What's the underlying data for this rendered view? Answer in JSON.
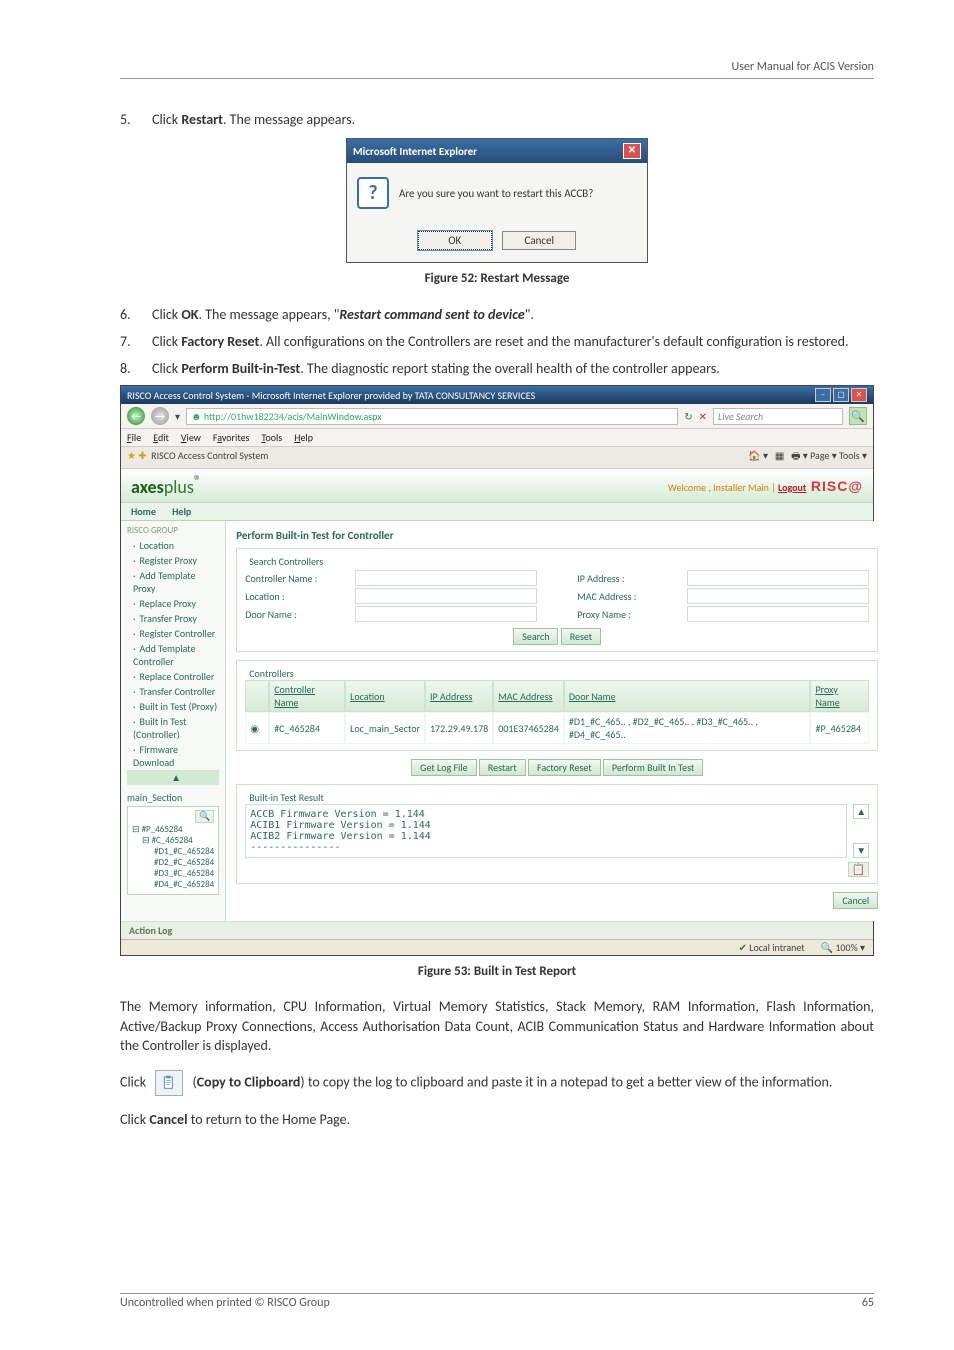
{
  "header": {
    "doc_title": "User Manual for ACIS Version"
  },
  "list": {
    "i5": {
      "num": "5.",
      "pre": "Click ",
      "b": "Restart",
      "post": ". The message appears."
    },
    "i6": {
      "num": "6.",
      "pre": "Click ",
      "b": "OK",
      "mid": ". The message appears, \"",
      "bi": "Restart command sent to device",
      "post": "\"."
    },
    "i7": {
      "num": "7.",
      "pre": "Click ",
      "b": "Factory Reset",
      "post": ". All configurations on the Controllers are reset and the manufacturer's default configuration is restored."
    },
    "i8": {
      "num": "8.",
      "pre": "Click ",
      "b": "Perform Built-in-Test",
      "post": ". The diagnostic report stating the overall health of the controller appears."
    }
  },
  "dialog": {
    "title": "Microsoft Internet Explorer",
    "message": "Are you sure you want to restart this ACCB?",
    "ok": "OK",
    "cancel": "Cancel"
  },
  "caption1": "Figure 52: Restart Message",
  "browser": {
    "titlebar": "RISCO Access Control System - Microsoft Internet Explorer provided by TATA CONSULTANCY SERVICES",
    "url": "http://01hw182234/acis/MainWindow.aspx",
    "search_placeholder": "Live Search",
    "menus": {
      "file": "File",
      "edit": "Edit",
      "view": "View",
      "fav": "Favorites",
      "tools": "Tools",
      "help": "Help"
    },
    "tab_label": "RISCO Access Control System",
    "toolbar_right": "Page ▾   Tools ▾",
    "brand_html": "axesplus",
    "welcome": "Welcome ,  Installer Main  |  ",
    "logout": "Logout",
    "logo": "RISC@",
    "apptabs": {
      "home": "Home",
      "help": "Help"
    },
    "sidebar": {
      "group": "RISCO GROUP",
      "items": [
        "Location",
        "Register Proxy",
        "Add Template Proxy",
        "Replace Proxy",
        "Transfer Proxy",
        "Register Controller",
        "Add Template Controller",
        "Replace Controller",
        "Transfer Controller",
        "Built in Test (Proxy)",
        "Built in Test (Controller)",
        "Firmware Download"
      ],
      "section": "main_Section",
      "tree": [
        "#P_465284",
        "#C_465284",
        "#D1_#C_465284",
        "#D2_#C_465284",
        "#D3_#C_465284",
        "#D4_#C_465284"
      ]
    },
    "main": {
      "heading": "Perform Built-in Test for Controller",
      "fs_search": {
        "legend": "Search Controllers",
        "ctrlname": "Controller Name :",
        "location": "Location :",
        "doorname": "Door Name :",
        "ip": "IP Address :",
        "mac": "MAC Address :",
        "proxy": "Proxy Name :",
        "search": "Search",
        "reset": "Reset"
      },
      "fs_ctrl": {
        "legend": "Controllers",
        "cols": [
          "Controller Name",
          "Location",
          "IP Address",
          "MAC Address",
          "Door Name",
          "Proxy Name"
        ],
        "row": {
          "sel": "◉",
          "name": "#C_465284",
          "loc": "Loc_main_Sector",
          "ip": "172.29.49.178",
          "mac": "001E37465284",
          "doors": "#D1_#C_465.. , #D2_#C_465.. , #D3_#C_465.. , #D4_#C_465..",
          "proxy": "#P_465284"
        }
      },
      "btns": {
        "getlog": "Get Log File",
        "restart": "Restart",
        "factory": "Factory Reset",
        "perform": "Perform Built In Test"
      },
      "fs_result": {
        "legend": "Built-in Test Result",
        "lines": [
          "ACCB Firmware Version = 1.144",
          "ACIB1 Firmware Version = 1.144",
          "ACIB2 Firmware Version = 1.144",
          "---------------"
        ]
      },
      "cancel": "Cancel"
    },
    "actionlog": "Action Log",
    "status": {
      "zone": "Local intranet",
      "zoom": "100%"
    }
  },
  "caption2": "Figure 53: Built in Test Report",
  "para1": "The Memory information, CPU Information, Virtual Memory Statistics, Stack Memory, RAM Information, Flash Information, Active/Backup Proxy Connections, Access Authorisation Data Count, ACIB Communication Status and Hardware Information about the Controller is displayed.",
  "para2": {
    "pre": "Click ",
    "mid1": " (",
    "b": "Copy to Clipboard",
    "mid2": ") to copy the log to clipboard and paste it in a notepad to get a better view of the information."
  },
  "para3": {
    "pre": "Click ",
    "b": "Cancel",
    "post": " to return to the Home Page."
  },
  "footer": {
    "left": "Uncontrolled when printed © RISCO Group",
    "right": "65"
  }
}
